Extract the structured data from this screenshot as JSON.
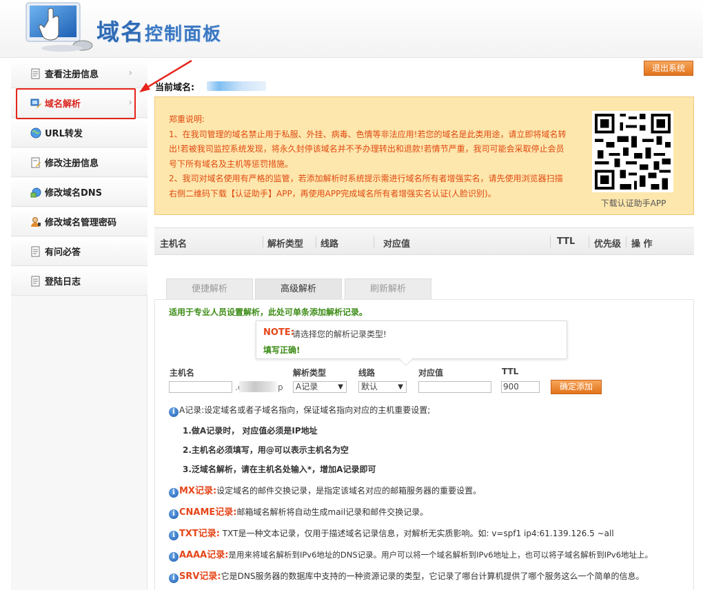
{
  "header": {
    "title_big": "域名",
    "title_small": "控制面板"
  },
  "sidebar": {
    "items": [
      {
        "label": "查看注册信息",
        "icon": "document-icon"
      },
      {
        "label": "域名解析",
        "icon": "dns-edit-icon"
      },
      {
        "label": "URL转发",
        "icon": "globe-icon"
      },
      {
        "label": "修改注册信息",
        "icon": "edit-document-icon"
      },
      {
        "label": "修改域名DNS",
        "icon": "dns-globe-icon"
      },
      {
        "label": "修改域名管理密码",
        "icon": "user-key-icon"
      },
      {
        "label": "有问必答",
        "icon": "document-icon"
      },
      {
        "label": "登陆日志",
        "icon": "document-icon"
      }
    ],
    "chevron": "›"
  },
  "toolbar": {
    "logout_label": "退出系统"
  },
  "domain": {
    "label": "当前域名:"
  },
  "notice": {
    "heading": "郑重说明:",
    "p1": "1、在我司管理的域名禁止用于私服、外挂、病毒、色情等非法应用!若您的域名是此类用途，请立即将域名转出!若被我司监控系统发现，将永久封停该域名并不予办理转出和退款!若情节严重，我司可能会采取停止会员号下所有域名及主机等惩罚措施。",
    "p2": "2、我司对域名使用有严格的监管，若添加解析时系统提示需进行域名所有者增强实名，请先使用浏览器扫描右侧二维码下载【认证助手】APP，再使用APP完成域名所有者增强实名认证(人脸识别)。",
    "qr_caption": "下载认证助手APP"
  },
  "table": {
    "columns": [
      "主机名",
      "解析类型",
      "线路",
      "对应值",
      "TTL",
      "优先级",
      "操 作"
    ]
  },
  "tabs": [
    {
      "label": "便捷解析"
    },
    {
      "label": "高级解析"
    },
    {
      "label": "刷新解析"
    }
  ],
  "panel": {
    "title": "适用于专业人员设置解析，此处可单条添加解析记录。",
    "tooltip_note_label": "NOTE:",
    "tooltip_note_text": "请选择您的解析记录类型!",
    "tooltip_ok": "填写正确!"
  },
  "form": {
    "host_label": "主机名",
    "type_label": "解析类型",
    "line_label": "线路",
    "value_label": "对应值",
    "ttl_label": "TTL",
    "host_value": "",
    "domain_suffix": ".c",
    "domain_suffix_end": "p",
    "type_value": "A记录",
    "line_value": "默认",
    "value_value": "",
    "ttl_value": "900",
    "submit_label": "确定添加"
  },
  "help": {
    "a_text": "A记录:设定域名或者子域名指向，保证域名指向对应的主机重要设置;",
    "a_sub1": "1.做A记录时，  对应值必须是IP地址",
    "a_sub2": "2.主机名必须填写，用@可以表示主机名为空",
    "a_sub3": "3.泛域名解析，请在主机名处输入*，增加A记录即可",
    "mx_label": "MX记录:",
    "mx_text": "设定域名的邮件交换记录，是指定该域名对应的邮箱服务器的重要设置。",
    "cname_label": "CNAME记录:",
    "cname_text": "邮箱域名解析将自动生成mail记录和邮件交换记录。",
    "txt_label": "TXT记录:",
    "txt_text": " TXT是一种文本记录，仅用于描述域名记录信息，对解析无实质影响。如: v=spf1 ip4:61.139.126.5 ~all",
    "aaaa_label": "AAAA记录:",
    "aaaa_text": "是用来将域名解析到IPv6地址的DNS记录。用户可以将一个域名解析到IPv6地址上，也可以将子域名解析到IPv6地址上。",
    "srv_label": "SRV记录:",
    "srv_text": "它是DNS服务器的数据库中支持的一种资源记录的类型，它记录了哪台计算机提供了哪个服务这么一个简单的信息。",
    "info_glyph": "i"
  },
  "colors": {
    "accent_blue": "#2f6bb4",
    "highlight_red": "#e5231a",
    "button_orange": "#e2731b",
    "notice_bg": "#fde7ad",
    "notice_text": "#e04a10",
    "ok_green": "#3c8c16"
  }
}
